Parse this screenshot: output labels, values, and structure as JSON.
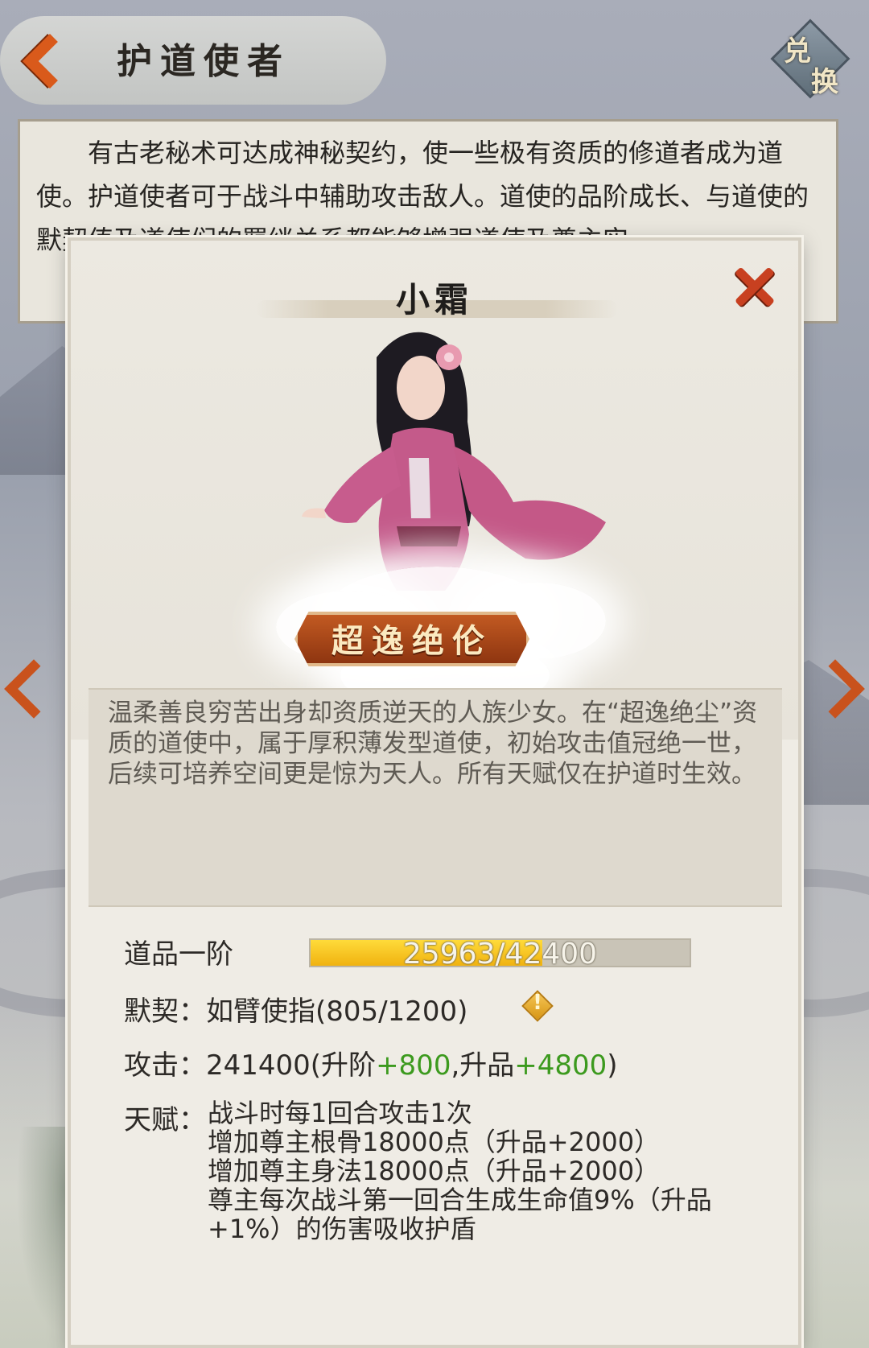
{
  "header": {
    "title": "护道使者",
    "exchange_label_1": "兑",
    "exchange_label_2": "换"
  },
  "intro": {
    "text": "有古老秘术可达成神秘契约，使一些极有资质的修道者成为道使。护道使者可于战斗中辅助攻击敌人。道使的品阶成长、与道使的默契值及道使们的羁绊关系都能够增强道使及尊主实"
  },
  "dialog": {
    "hero_name": "小霜",
    "grade": "超逸绝伦",
    "description": "温柔善良穷苦出身却资质逆天的人族少女。在“超逸绝尘”资质的道使中，属于厚积薄发型道使，初始攻击值冠绝一世，后续可培养空间更是惊为天人。所有天赋仅在护道时生效。",
    "level_label": "道品一阶",
    "exp": {
      "text": "25963/42400",
      "current": 25963,
      "max": 42400
    },
    "bond": {
      "label": "默契：",
      "value": "如臂使指(805/1200)"
    },
    "attack": {
      "label": "攻击：",
      "base": "241400(升阶",
      "upgrade_bonus": "+800",
      "mid": ",升品",
      "rank_bonus": "+4800",
      "end": ")"
    },
    "talent": {
      "label": "天赋：",
      "lines": [
        "战斗时每1回合攻击1次",
        "增加尊主根骨18000点（升品+2000）",
        "增加尊主身法18000点（升品+2000）",
        "尊主每次战斗第一回合生成生命值9%（升品+1%）的伤害吸收护盾"
      ]
    },
    "warn_mark": "!"
  },
  "colors": {
    "accent_orange": "#c9521c",
    "bonus_green": "#3c9a1e",
    "exp_fill": "#f0b210"
  },
  "icons": [
    "back-arrow-icon",
    "exchange-icon",
    "close-icon",
    "warning-icon",
    "prev-arrow-icon",
    "next-arrow-icon"
  ]
}
